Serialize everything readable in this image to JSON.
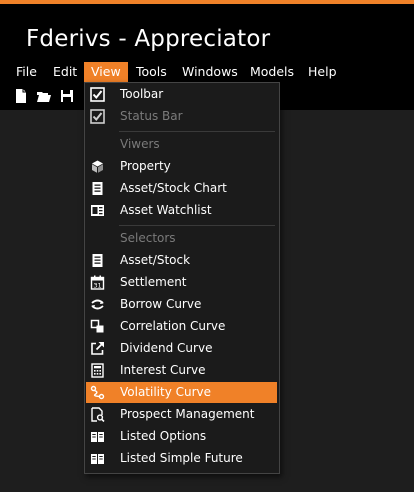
{
  "app": {
    "title": "Fderivs - Appreciator"
  },
  "colors": {
    "accent": "#f08128",
    "background": "#1e1e1e",
    "chrome": "#000000",
    "disabled_text": "#7a7a7a"
  },
  "menubar": {
    "items": [
      {
        "label": "File"
      },
      {
        "label": "Edit"
      },
      {
        "label": "View",
        "active": true
      },
      {
        "label": "Tools"
      },
      {
        "label": "Windows"
      },
      {
        "label": "Models"
      },
      {
        "label": "Help"
      }
    ]
  },
  "toolbar": {
    "icons": [
      "new-file-icon",
      "open-folder-icon",
      "save-icon"
    ]
  },
  "view_menu": {
    "items": [
      {
        "type": "item",
        "label": "Toolbar",
        "icon": "checkbox-checked-icon",
        "enabled": true,
        "checked": true
      },
      {
        "type": "item",
        "label": "Status Bar",
        "icon": "checkbox-checked-icon",
        "enabled": false,
        "checked": true
      },
      {
        "type": "header",
        "label": "Viwers"
      },
      {
        "type": "item",
        "label": "Property",
        "icon": "cube-icon",
        "enabled": true
      },
      {
        "type": "item",
        "label": "Asset/Stock Chart",
        "icon": "document-list-icon",
        "enabled": true
      },
      {
        "type": "item",
        "label": "Asset Watchlist",
        "icon": "watchlist-icon",
        "enabled": true
      },
      {
        "type": "header",
        "label": "Selectors"
      },
      {
        "type": "item",
        "label": "Asset/Stock",
        "icon": "document-list-icon",
        "enabled": true
      },
      {
        "type": "item",
        "label": "Settlement",
        "icon": "calendar-icon",
        "enabled": true
      },
      {
        "type": "item",
        "label": "Borrow Curve",
        "icon": "curve-arrows-icon",
        "enabled": true
      },
      {
        "type": "item",
        "label": "Correlation Curve",
        "icon": "correlation-icon",
        "enabled": true
      },
      {
        "type": "item",
        "label": "Dividend Curve",
        "icon": "external-link-icon",
        "enabled": true
      },
      {
        "type": "item",
        "label": "Interest Curve",
        "icon": "calculator-icon",
        "enabled": true
      },
      {
        "type": "item",
        "label": "Volatility Curve",
        "icon": "volatility-icon",
        "enabled": true,
        "highlighted": true
      },
      {
        "type": "item",
        "label": "Prospect Management",
        "icon": "document-search-icon",
        "enabled": true
      },
      {
        "type": "item",
        "label": "Listed Options",
        "icon": "book-icon",
        "enabled": true
      },
      {
        "type": "item",
        "label": "Listed Simple Future",
        "icon": "book-icon",
        "enabled": true
      }
    ]
  }
}
